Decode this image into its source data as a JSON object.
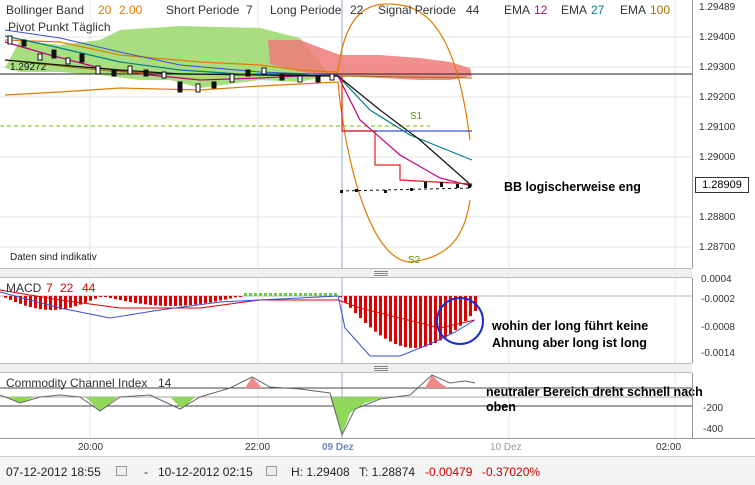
{
  "header": {
    "bb_label": "Bollinger Band",
    "bb_period": "20",
    "bb_dev": "2.00",
    "short_label": "Short Periode",
    "short_value": "7",
    "long_label": "Long Periode",
    "long_value": "22",
    "signal_label": "Signal Periode",
    "signal_value": "44",
    "ema1_label": "EMA",
    "ema1_value": "12",
    "ema2_label": "EMA",
    "ema2_value": "27",
    "ema3_label": "EMA",
    "ema3_value": "100",
    "pivot_label": "Pivot Punkt Täglich"
  },
  "main_chart": {
    "level_marker": "1.29272",
    "s1_label": "S1",
    "s2_label": "S2",
    "daten_note": "Daten sind indikativ",
    "annotation": "BB logischerweise eng",
    "price_ticks": [
      "1.29489",
      "1.29400",
      "1.29300",
      "1.29200",
      "1.29100",
      "1.29000",
      "1.28800",
      "1.28700"
    ],
    "current_price": "1.28909"
  },
  "macd": {
    "label": "MACD",
    "p1": "7",
    "p2": "22",
    "p3": "44",
    "ticks": [
      "0.0004",
      "-0.0002",
      "-0.0008",
      "-0.0014"
    ],
    "annotation_line1": "wohin der long führt keine",
    "annotation_line2": "Ahnung aber long ist long"
  },
  "cci": {
    "label": "Commodity Channel Index",
    "period": "14",
    "ticks": [
      "-200",
      "-400"
    ],
    "annotation_line1": "neutraler Bereich dreht schnell nach",
    "annotation_line2": "oben"
  },
  "time_axis": {
    "labels": [
      "20:00",
      "22:00",
      "09 Dez",
      "10 Dez",
      "02:00"
    ]
  },
  "status_bar": {
    "from": "07-12-2012 18:55",
    "dash": "-",
    "to": "10-12-2012 02:15",
    "high": "H: 1.29408",
    "close": "T: 1.28874",
    "change": "-0.00479",
    "change_pct": "-0.37020%"
  },
  "colors": {
    "bb": "#e07b00",
    "ema12": "#c0007a",
    "ema27": "#00808a",
    "ema100": "#a07000",
    "macd_bar": "#dd0000",
    "macd_pos": "#66cc44",
    "cloud_green": "#9ad86a",
    "cloud_red": "#f07a7a",
    "circle": "#1a2ecc",
    "negative": "#cc0000"
  }
}
